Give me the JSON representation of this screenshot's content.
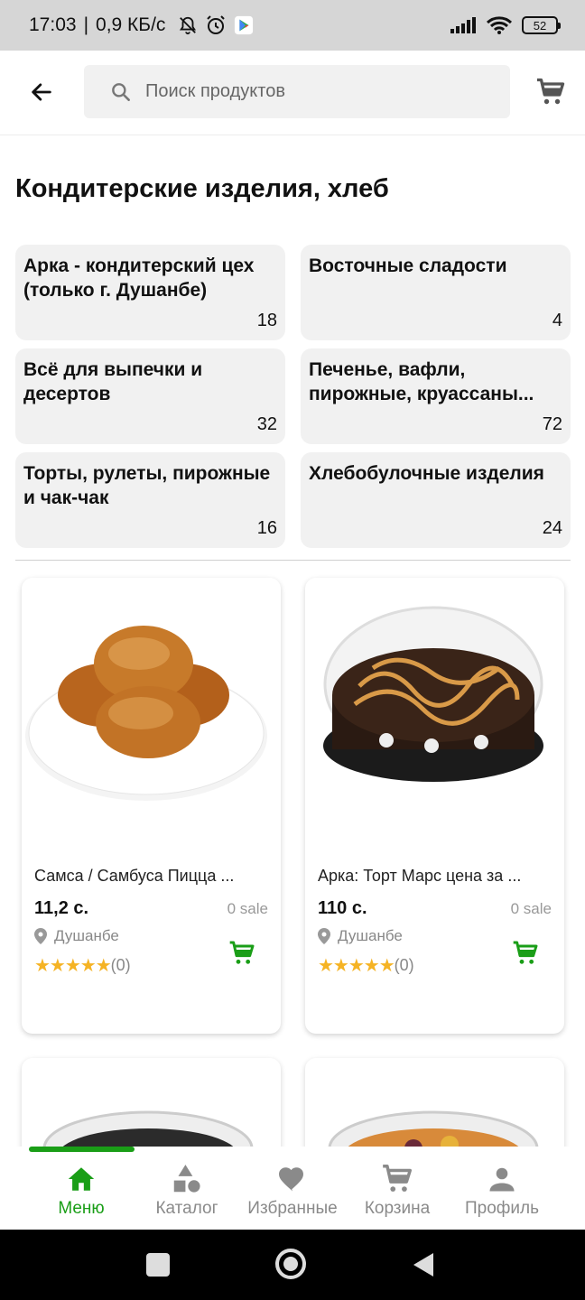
{
  "status_bar": {
    "time": "17:03",
    "separator": "|",
    "speed": "0,9 КБ/с",
    "battery": "52"
  },
  "header": {
    "search_placeholder": "Поиск продуктов"
  },
  "page_title": "Кондитерские изделия, хлеб",
  "subcategories": [
    {
      "name": "Арка - кондитерский цех (только г. Душанбе)",
      "count": "18"
    },
    {
      "name": "Восточные сладости",
      "count": "4"
    },
    {
      "name": "Всё для выпечки и десертов",
      "count": "32"
    },
    {
      "name": "Печенье, вафли, пирожные, круассаны...",
      "count": "72"
    },
    {
      "name": "Торты, рулеты, пирожные и чак-чак",
      "count": "16"
    },
    {
      "name": "Хлебобулочные изделия",
      "count": "24"
    }
  ],
  "products": [
    {
      "name": "Самса / Самбуса Пицца ...",
      "price": "11,2 с.",
      "sales": "0 sale",
      "city": "Душанбе",
      "rating": "(0)"
    },
    {
      "name": "Арка: Торт Марс цена за ...",
      "price": "110 с.",
      "sales": "0 sale",
      "city": "Душанбе",
      "rating": "(0)"
    }
  ],
  "stars": "★★★★★",
  "bottom_nav": [
    {
      "label": "Меню",
      "icon": "home-icon",
      "active": true
    },
    {
      "label": "Каталог",
      "icon": "catalog-icon",
      "active": false
    },
    {
      "label": "Избранные",
      "icon": "heart-icon",
      "active": false
    },
    {
      "label": "Корзина",
      "icon": "cart-icon",
      "active": false
    },
    {
      "label": "Профиль",
      "icon": "profile-icon",
      "active": false
    }
  ],
  "colors": {
    "accent": "#1a9e17",
    "star": "#f5b324",
    "tile_bg": "#f1f1f1"
  }
}
